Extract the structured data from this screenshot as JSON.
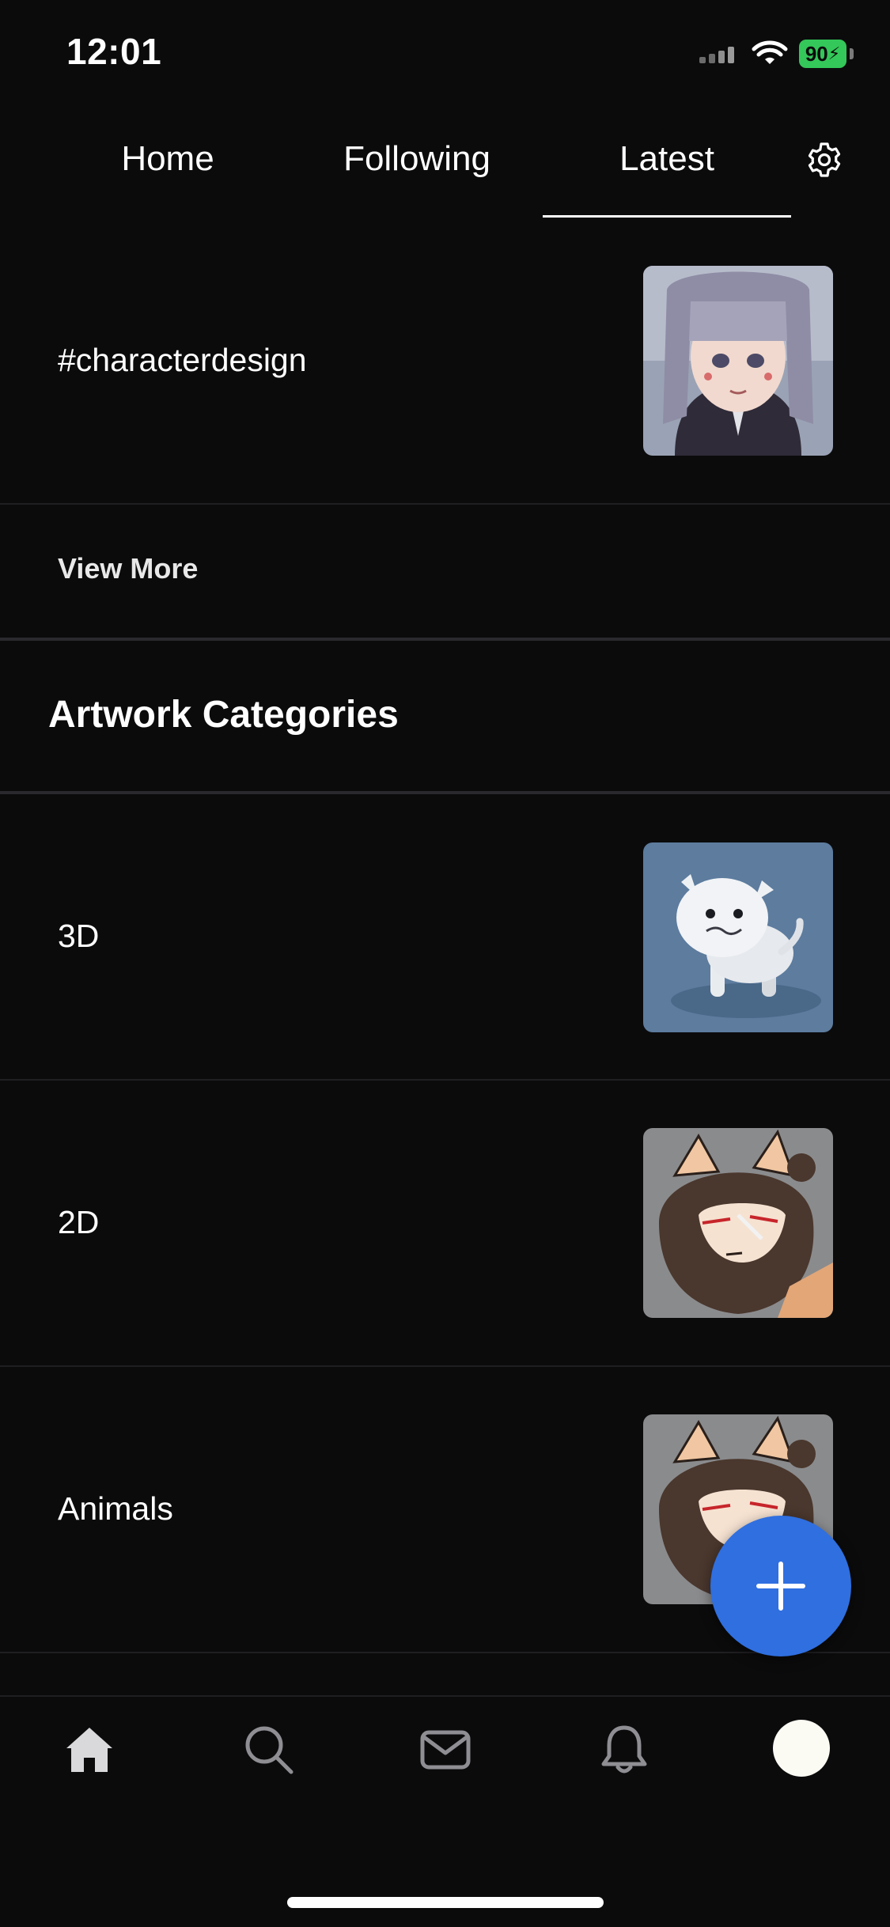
{
  "status_bar": {
    "time": "12:01",
    "battery": "90"
  },
  "tabs": [
    {
      "label": "Home"
    },
    {
      "label": "Following"
    },
    {
      "label": "Latest",
      "active": true
    }
  ],
  "tag_row": {
    "label": "#characterdesign"
  },
  "view_more": "View More",
  "section_title": "Artwork Categories",
  "categories": [
    {
      "label": "3D"
    },
    {
      "label": "2D"
    },
    {
      "label": "Animals"
    }
  ],
  "icons": {
    "settings": "gear-icon",
    "fab": "plus-icon",
    "nav": [
      "home-icon",
      "search-icon",
      "mail-icon",
      "bell-icon",
      "avatar"
    ]
  },
  "colors": {
    "background": "#0b0b0c",
    "accent": "#2f6fe0",
    "battery": "#34c759"
  }
}
